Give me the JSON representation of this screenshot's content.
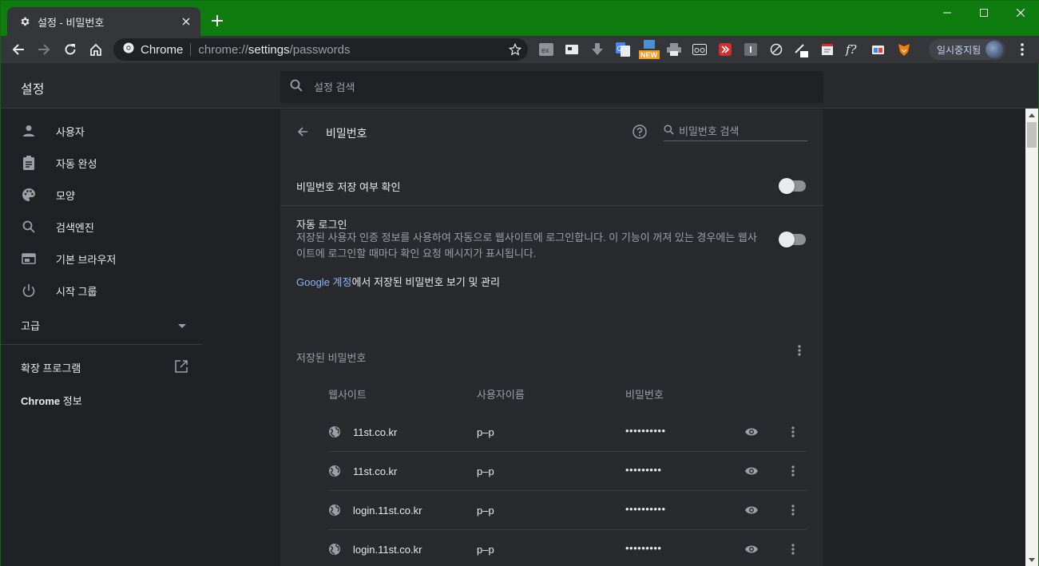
{
  "tab": {
    "title": "설정 - 비밀번호",
    "icon": "gear-icon"
  },
  "toolbar": {
    "site_name": "Chrome",
    "url_scheme": "chrome://",
    "url_host": "settings",
    "url_path": "/passwords",
    "extension_badge": "NEW"
  },
  "profile": {
    "label": "일시중지됨"
  },
  "settings": {
    "header_title": "설정",
    "search_placeholder": "설정 검색"
  },
  "sidebar": {
    "items": [
      {
        "label": "사용자",
        "icon": "person-icon"
      },
      {
        "label": "자동 완성",
        "icon": "clipboard-icon"
      },
      {
        "label": "모양",
        "icon": "palette-icon"
      },
      {
        "label": "검색엔진",
        "icon": "search-icon"
      },
      {
        "label": "기본 브라우저",
        "icon": "browser-icon"
      },
      {
        "label": "시작 그룹",
        "icon": "power-icon"
      }
    ],
    "advanced_label": "고급",
    "extensions_label": "확장 프로그램",
    "about_bold": "Chrome",
    "about_rest": " 정보"
  },
  "passwords": {
    "title": "비밀번호",
    "search_placeholder": "비밀번호 검색",
    "offer_save_label": "비밀번호 저장 여부 확인",
    "offer_save_enabled": false,
    "autosignin_label": "자동 로그인",
    "autosignin_desc": "저장된 사용자 인증 정보를 사용하여 자동으로 웹사이트에 로그인합니다. 이 기능이 꺼져 있는 경우에는 웹사이트에 로그인할 때마다 확인 요청 메시지가 표시됩니다.",
    "autosignin_enabled": false,
    "google_link": "Google 계정",
    "google_rest": "에서 저장된 비밀번호 보기 및 관리",
    "saved_title": "저장된 비밀번호",
    "columns": {
      "website": "웹사이트",
      "username": "사용자이름",
      "password": "비밀번호"
    },
    "rows": [
      {
        "site": "11st.co.kr",
        "user": "p–p",
        "pass": "••••••••••"
      },
      {
        "site": "11st.co.kr",
        "user": "p–p",
        "pass": "•••••••••"
      },
      {
        "site": "login.11st.co.kr",
        "user": "p–p",
        "pass": "••••••••••"
      },
      {
        "site": "login.11st.co.kr",
        "user": "p–p",
        "pass": "•••••••••"
      }
    ]
  },
  "colors": {
    "title_bar": "#0f7c10",
    "surface": "#292a2d",
    "background": "#202124",
    "link": "#8ab4f8"
  }
}
